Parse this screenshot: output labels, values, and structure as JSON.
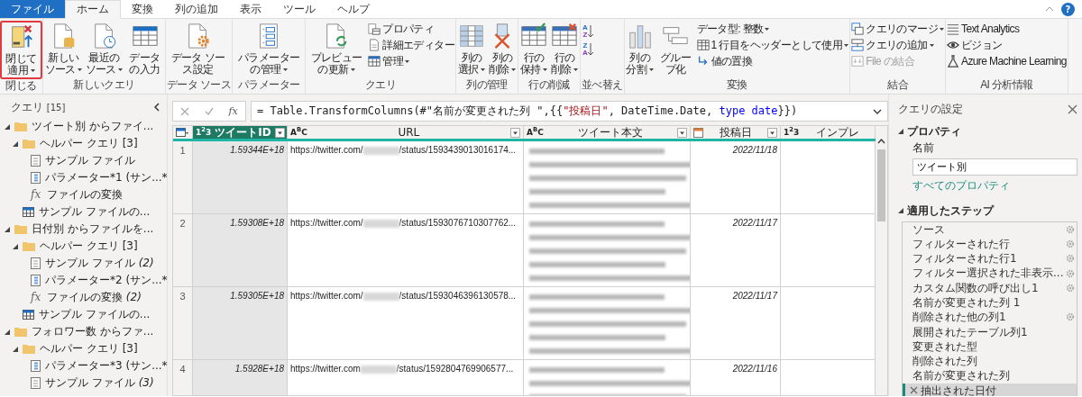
{
  "tabs": [
    {
      "label": "ファイル",
      "kind": "file",
      "selected": false
    },
    {
      "label": "ホーム",
      "kind": "tab",
      "selected": true
    },
    {
      "label": "変換",
      "kind": "tab",
      "selected": false
    },
    {
      "label": "列の追加",
      "kind": "tab",
      "selected": false
    },
    {
      "label": "表示",
      "kind": "tab",
      "selected": false
    },
    {
      "label": "ツール",
      "kind": "tab",
      "selected": false
    },
    {
      "label": "ヘルプ",
      "kind": "tab",
      "selected": false
    }
  ],
  "help": {
    "label": "?"
  },
  "ribbon": [
    {
      "label": "閉じる",
      "items": [
        {
          "kind": "large",
          "label": "閉じて適用",
          "dropdown": true,
          "highlighted": true
        }
      ]
    },
    {
      "label": "新しいクエリ",
      "items": [
        {
          "kind": "large",
          "label": "新しいソース",
          "dropdown": true,
          "highlighted": false
        },
        {
          "kind": "large",
          "label": "最近のソース",
          "dropdown": true,
          "highlighted": false
        },
        {
          "kind": "large",
          "label": "データの入力",
          "dropdown": false,
          "highlighted": false
        }
      ]
    },
    {
      "label": "データ ソース",
      "items": [
        {
          "kind": "large",
          "label": "データ ソース設定",
          "dropdown": false,
          "highlighted": false
        }
      ]
    },
    {
      "label": "パラメーター",
      "items": [
        {
          "kind": "large",
          "label": "パラメーターの管理",
          "dropdown": true,
          "highlighted": false
        }
      ]
    },
    {
      "label": "クエリ",
      "items": [
        {
          "kind": "large",
          "label": "プレビューの更新",
          "dropdown": true,
          "highlighted": false
        },
        {
          "kind": "stack",
          "entries": [
            {
              "label": "プロパティ",
              "dropdown": false,
              "disabled": false
            },
            {
              "label": "詳細エディター",
              "dropdown": false,
              "disabled": false
            },
            {
              "label": "管理",
              "dropdown": true,
              "disabled": false
            }
          ]
        }
      ]
    },
    {
      "label": "列の管理",
      "items": [
        {
          "kind": "large",
          "label": "列の選択",
          "dropdown": true,
          "highlighted": false
        },
        {
          "kind": "large",
          "label": "列の削除",
          "dropdown": true,
          "highlighted": false
        }
      ]
    },
    {
      "label": "行の削減",
      "items": [
        {
          "kind": "large",
          "label": "行の保持",
          "dropdown": true,
          "highlighted": false
        },
        {
          "kind": "large",
          "label": "行の削除",
          "dropdown": true,
          "highlighted": false
        }
      ]
    },
    {
      "label": "並べ替え",
      "items": [
        {
          "kind": "sort",
          "entries": [
            {
              "top": "A",
              "bottom": "Z"
            },
            {
              "top": "Z",
              "bottom": "A"
            }
          ]
        }
      ]
    },
    {
      "label": "変換",
      "items": [
        {
          "kind": "large",
          "label": "列の分割",
          "dropdown": true,
          "highlighted": false
        },
        {
          "kind": "large",
          "label": "グループ化",
          "dropdown": false,
          "highlighted": false
        },
        {
          "kind": "stack",
          "entries": [
            {
              "label": "データ型: 整数",
              "dropdown": true,
              "disabled": false
            },
            {
              "label": "1 行目をヘッダーとして使用",
              "dropdown": true,
              "disabled": false
            },
            {
              "label": "値の置換",
              "dropdown": false,
              "disabled": false
            }
          ]
        }
      ]
    },
    {
      "label": "結合",
      "items": [
        {
          "kind": "stack",
          "entries": [
            {
              "label": "クエリのマージ",
              "dropdown": true,
              "disabled": false
            },
            {
              "label": "クエリの追加",
              "dropdown": true,
              "disabled": false
            },
            {
              "label": "File の結合",
              "dropdown": false,
              "disabled": true
            }
          ]
        }
      ]
    },
    {
      "label": "AI 分析情報",
      "items": [
        {
          "kind": "stack",
          "entries": [
            {
              "label": "Text Analytics",
              "dropdown": false,
              "disabled": false
            },
            {
              "label": "ビジョン",
              "dropdown": false,
              "disabled": false
            },
            {
              "label": "Azure Machine Learning",
              "dropdown": false,
              "disabled": false
            }
          ]
        }
      ]
    }
  ],
  "queries_pane": {
    "title": "クエリ",
    "count": "[15]",
    "tree": [
      {
        "label": "ツイート別 からファイ...",
        "kind": "folder",
        "expanded": true,
        "children": [
          {
            "label": "ヘルパー クエリ [3]",
            "kind": "folder",
            "expanded": true,
            "children": [
              {
                "label": "サンプル ファイル",
                "kind": "file"
              },
              {
                "label": "パラメーター*1 (サン...*",
                "kind": "parameter"
              },
              {
                "label": "ファイルの変換",
                "kind": "function",
                "glyph": "fx"
              }
            ]
          },
          {
            "label": "サンプル ファイルの...",
            "kind": "table"
          }
        ]
      },
      {
        "label": "日付別 からファイルを...",
        "kind": "folder",
        "expanded": true,
        "children": [
          {
            "label": "ヘルパー クエリ [3]",
            "kind": "folder",
            "expanded": true,
            "children": [
              {
                "label": "サンプル ファイル *(2)*",
                "kind": "file"
              },
              {
                "label": "パラメーター*2 (サン...*",
                "kind": "parameter"
              },
              {
                "label": "ファイルの変換 *(2)*",
                "kind": "function",
                "glyph": "fx"
              }
            ]
          },
          {
            "label": "サンプル ファイルの...",
            "kind": "table"
          }
        ]
      },
      {
        "label": "フォロワー数 からファ...",
        "kind": "folder",
        "expanded": true,
        "children": [
          {
            "label": "ヘルパー クエリ [3]",
            "kind": "folder",
            "expanded": true,
            "children": [
              {
                "label": "パラメーター*3 (サン...*",
                "kind": "parameter"
              },
              {
                "label": "サンプル ファイル *(3)*",
                "kind": "file"
              }
            ]
          }
        ]
      }
    ]
  },
  "formula_bar": {
    "fx": "fx",
    "segments": [
      {
        "kind": "plain",
        "text": "= Table.TransformColumns(#\"名前が変更された列 \",{{"
      },
      {
        "kind": "string",
        "text": "\"投稿日\""
      },
      {
        "kind": "plain",
        "text": ", DateTime.Date, "
      },
      {
        "kind": "keyword",
        "text": "type date"
      },
      {
        "kind": "plain",
        "text": "}})"
      }
    ]
  },
  "table": {
    "columns": [
      {
        "kind": "number",
        "type_label": "1$^{2}$3",
        "title": "ツイートID",
        "selected": true,
        "dropdown": true
      },
      {
        "kind": "text",
        "type_label": "A$^{B}$C",
        "title": "URL",
        "selected": false,
        "dropdown": true
      },
      {
        "kind": "text",
        "type_label": "A$^{B}$C",
        "title": "ツイート本文",
        "selected": false,
        "dropdown": true
      },
      {
        "kind": "date",
        "title": "投稿日",
        "selected": false,
        "dropdown": true
      },
      {
        "kind": "number",
        "type_label": "1$^{2}$3",
        "title": "インプレ",
        "selected": false,
        "dropdown": false
      }
    ],
    "rows": [
      {
        "index": "1",
        "id": "1.59344E+18",
        "url_prefix": "https://twitter.com/",
        "url_suffix": "/status/1593439013016174...",
        "date": "2022/11/18"
      },
      {
        "index": "2",
        "id": "1.59308E+18",
        "url_prefix": "https://twitter.com/",
        "url_suffix": "/status/1593076710307762...",
        "date": "2022/11/17"
      },
      {
        "index": "3",
        "id": "1.59305E+18",
        "url_prefix": "https://twitter.com/",
        "url_suffix": "/status/1593046396130578...",
        "date": "2022/11/17"
      },
      {
        "index": "4",
        "id": "1.5928E+18",
        "url_prefix": "https://twitter.com",
        "url_suffix": "/status/1592804769906577...",
        "date": "2022/11/16"
      }
    ]
  },
  "settings_pane": {
    "title": "クエリの設定",
    "properties_heading": "プロパティ",
    "name_label": "名前",
    "name_value": "ツイート別",
    "all_properties_link": "すべてのプロパティ",
    "steps_heading": "適用したステップ",
    "steps": [
      {
        "label": "ソース",
        "settings": true,
        "selected": false
      },
      {
        "label": "フィルターされた行",
        "settings": true,
        "selected": false
      },
      {
        "label": "フィルターされた行1",
        "settings": true,
        "selected": false
      },
      {
        "label": "フィルター選択された非表示...",
        "settings": true,
        "selected": false
      },
      {
        "label": "カスタム関数の呼び出し1",
        "settings": true,
        "selected": false
      },
      {
        "label": "名前が変更された列 1",
        "settings": false,
        "selected": false
      },
      {
        "label": "削除された他の列1",
        "settings": true,
        "selected": false
      },
      {
        "label": "展開されたテーブル列1",
        "settings": false,
        "selected": false
      },
      {
        "label": "変更された型",
        "settings": false,
        "selected": false
      },
      {
        "label": "削除された列",
        "settings": false,
        "selected": false
      },
      {
        "label": "名前が変更された列",
        "settings": false,
        "selected": false
      },
      {
        "label": "抽出された日付",
        "settings": false,
        "selected": true
      }
    ]
  }
}
